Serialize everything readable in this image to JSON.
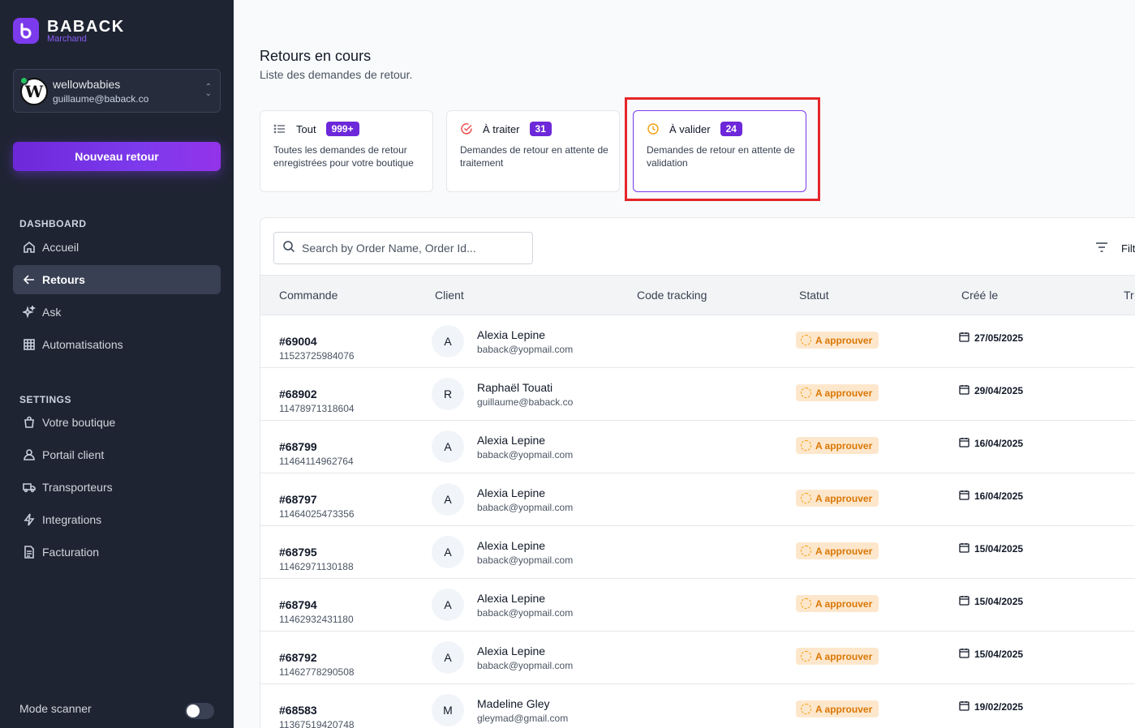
{
  "brand": {
    "name": "BABACK",
    "sub": "Marchand"
  },
  "shop": {
    "name": "wellowbabies",
    "email": "guillaume@baback.co",
    "avatar_letter": "W"
  },
  "sidebar": {
    "new_button": "Nouveau retour",
    "dashboard_title": "DASHBOARD",
    "dashboard_items": [
      {
        "label": "Accueil",
        "icon": "home-icon"
      },
      {
        "label": "Retours",
        "icon": "arrow-left-icon",
        "active": true
      },
      {
        "label": "Ask",
        "icon": "sparkles-icon"
      },
      {
        "label": "Automatisations",
        "icon": "grid-icon"
      }
    ],
    "settings_title": "SETTINGS",
    "settings_items": [
      {
        "label": "Votre boutique",
        "icon": "shopping-bag-icon"
      },
      {
        "label": "Portail client",
        "icon": "user-icon"
      },
      {
        "label": "Transporteurs",
        "icon": "truck-icon"
      },
      {
        "label": "Integrations",
        "icon": "bolt-icon"
      },
      {
        "label": "Facturation",
        "icon": "document-icon"
      }
    ],
    "scanner_label": "Mode scanner",
    "scanner_on": false
  },
  "page": {
    "title": "Retours en cours",
    "subtitle": "Liste des demandes de retour."
  },
  "tabs": [
    {
      "label": "Tout",
      "badge": "999+",
      "desc": "Toutes les demandes de retour enregistrées pour votre boutique",
      "icon": "list-icon"
    },
    {
      "label": "À traiter",
      "badge": "31",
      "desc": "Demandes de retour en attente de traitement",
      "icon": "check-circle-icon"
    },
    {
      "label": "À valider",
      "badge": "24",
      "desc": "Demandes de retour en attente de validation",
      "icon": "clock-icon",
      "selected": true
    }
  ],
  "search": {
    "placeholder": "Search by Order Name, Order Id..."
  },
  "filter_label": "Filt",
  "table": {
    "columns": [
      "Commande",
      "Client",
      "Code tracking",
      "Statut",
      "Créé le",
      "Tr"
    ],
    "rows": [
      {
        "order": "#69004",
        "order_id": "11523725984076",
        "initial": "A",
        "name": "Alexia Lepine",
        "email": "baback@yopmail.com",
        "tracking": "",
        "status": "A approuver",
        "date": "27/05/2025"
      },
      {
        "order": "#68902",
        "order_id": "11478971318604",
        "initial": "R",
        "name": "Raphaël Touati",
        "email": "guillaume@baback.co",
        "tracking": "",
        "status": "A approuver",
        "date": "29/04/2025"
      },
      {
        "order": "#68799",
        "order_id": "11464114962764",
        "initial": "A",
        "name": "Alexia Lepine",
        "email": "baback@yopmail.com",
        "tracking": "",
        "status": "A approuver",
        "date": "16/04/2025"
      },
      {
        "order": "#68797",
        "order_id": "11464025473356",
        "initial": "A",
        "name": "Alexia Lepine",
        "email": "baback@yopmail.com",
        "tracking": "",
        "status": "A approuver",
        "date": "16/04/2025"
      },
      {
        "order": "#68795",
        "order_id": "11462971130188",
        "initial": "A",
        "name": "Alexia Lepine",
        "email": "baback@yopmail.com",
        "tracking": "",
        "status": "A approuver",
        "date": "15/04/2025"
      },
      {
        "order": "#68794",
        "order_id": "11462932431180",
        "initial": "A",
        "name": "Alexia Lepine",
        "email": "baback@yopmail.com",
        "tracking": "",
        "status": "A approuver",
        "date": "15/04/2025"
      },
      {
        "order": "#68792",
        "order_id": "11462778290508",
        "initial": "A",
        "name": "Alexia Lepine",
        "email": "baback@yopmail.com",
        "tracking": "",
        "status": "A approuver",
        "date": "15/04/2025"
      },
      {
        "order": "#68583",
        "order_id": "11367519420748",
        "initial": "M",
        "name": "Madeline Gley",
        "email": "gleymad@gmail.com",
        "tracking": "",
        "status": "A approuver",
        "date": "19/02/2025"
      }
    ]
  },
  "colors": {
    "sidebar_bg": "#1f2433",
    "accent": "#7c3aed",
    "status_bg": "#fde7cc",
    "status_text": "#d97706",
    "highlight": "#e5262a"
  }
}
